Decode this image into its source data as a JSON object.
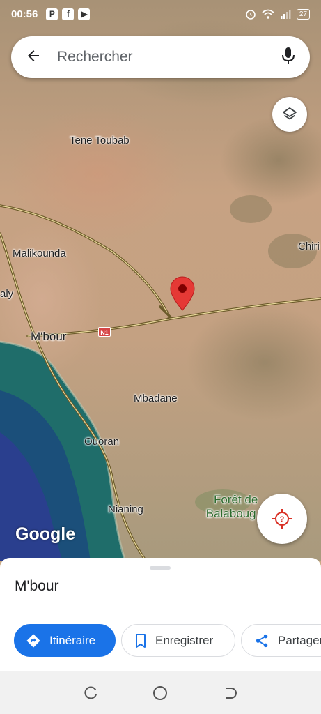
{
  "status_bar": {
    "time": "00:56",
    "app_icons": [
      "P",
      "f",
      "▶"
    ],
    "battery": "27"
  },
  "search": {
    "placeholder": "Rechercher"
  },
  "map": {
    "labels": {
      "tene_toubab": "Tene Toubab",
      "malikounda": "Malikounda",
      "aly": "aly",
      "mbour": "M'bour",
      "mbadane": "Mbadane",
      "ouoran": "Ouoran",
      "nianing": "Nianing",
      "chiri": "Chiri",
      "foret_line1": "Forêt de",
      "foret_line2": "Balaboug"
    },
    "road_shield": "N1",
    "attribution": "Google",
    "pin_color": "#e53935"
  },
  "sheet": {
    "place_title": "M'bour",
    "actions": {
      "directions": "Itinéraire",
      "save": "Enregistrer",
      "share": "Partager"
    }
  },
  "colors": {
    "accent": "#1a73e8",
    "water": "#1f6d6a"
  }
}
